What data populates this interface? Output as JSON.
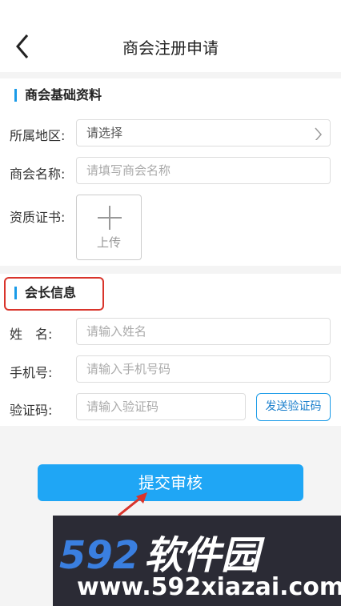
{
  "header": {
    "title": "商会注册申请"
  },
  "basic": {
    "title": "商会基础资料",
    "region_label": "所属地区:",
    "region_value": "请选择",
    "name_label": "商会名称:",
    "name_placeholder": "请填写商会名称",
    "cert_label": "资质证书:",
    "upload_label": "上传"
  },
  "president": {
    "title": "会长信息",
    "name_label": "姓　名:",
    "name_placeholder": "请输入姓名",
    "phone_label": "手机号:",
    "phone_placeholder": "请输入手机号码",
    "code_label": "验证码:",
    "code_placeholder": "请输入验证码",
    "send_code": "发送验证码"
  },
  "submit_label": "提交审核",
  "watermark": {
    "brand_num": "592",
    "brand_txt": "软件园",
    "url": "www.592xiazai.com"
  },
  "colors": {
    "accent": "#1fa6f5",
    "highlight": "#d9342b"
  }
}
